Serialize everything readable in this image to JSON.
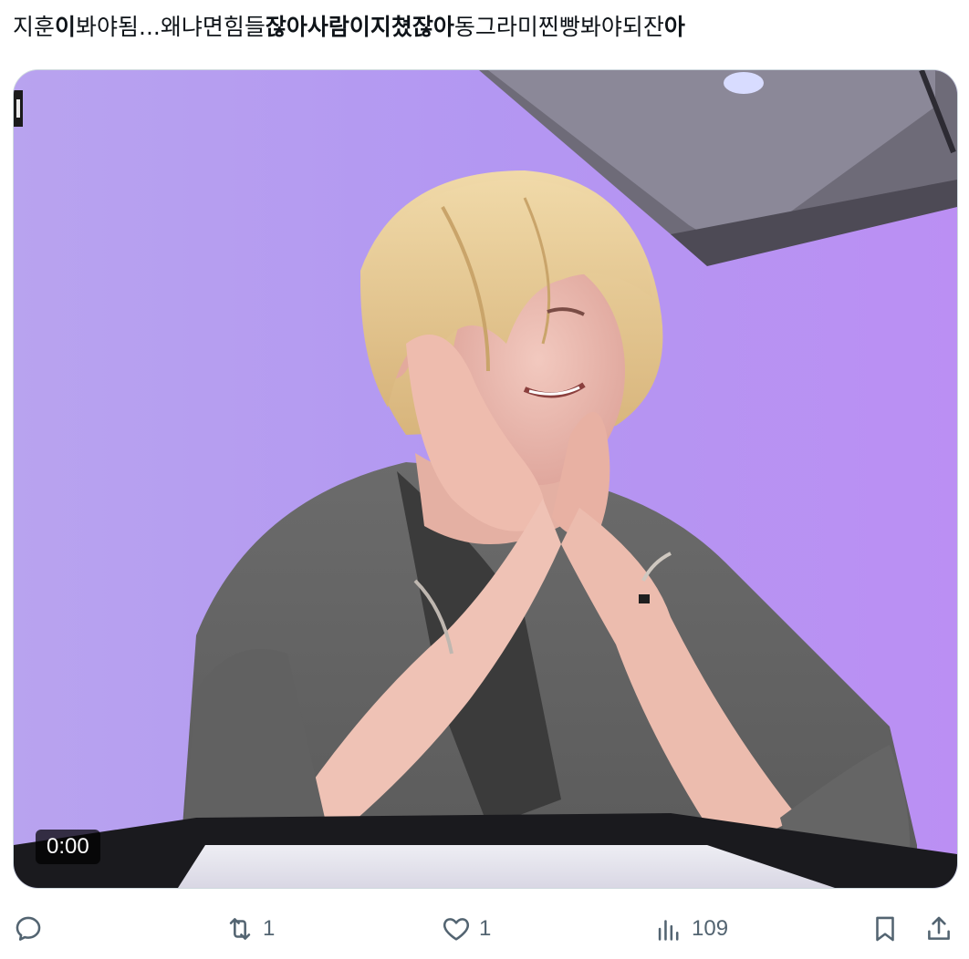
{
  "tweet": {
    "segments": [
      {
        "text": "지훈",
        "bold": false
      },
      {
        "text": "이",
        "bold": true
      },
      {
        "text": "봐야됨...왜냐면힘들",
        "bold": false
      },
      {
        "text": "잖아사람이지쳤잖아",
        "bold": true
      },
      {
        "text": "동그라미찐빵봐야되잔",
        "bold": false
      },
      {
        "text": "아",
        "bold": true
      }
    ]
  },
  "media": {
    "type": "video",
    "timestamp": "0:00"
  },
  "actions": {
    "reply": {
      "icon": "reply-icon",
      "count": ""
    },
    "retweet": {
      "icon": "retweet-icon",
      "count": "1"
    },
    "like": {
      "icon": "heart-icon",
      "count": "1"
    },
    "views": {
      "icon": "views-icon",
      "count": "109"
    },
    "bookmark": {
      "icon": "bookmark-icon"
    },
    "share": {
      "icon": "share-icon"
    }
  },
  "colors": {
    "icon": "#536471",
    "text": "#0f1419",
    "media_border": "#cfd9de",
    "video_background": "#b99cf0"
  }
}
